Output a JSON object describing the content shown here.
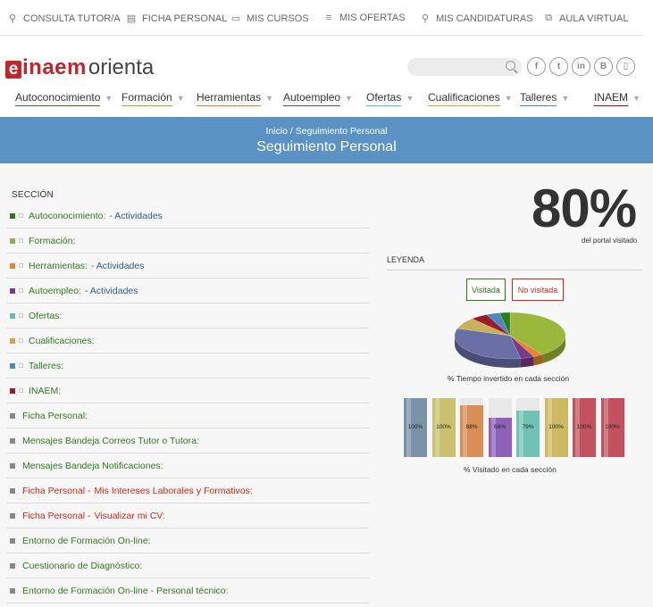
{
  "topbar": [
    {
      "icon": "consulta-icon",
      "glyph": "⚲",
      "label": "CONSULTA TUTOR/A"
    },
    {
      "icon": "ficha-icon",
      "glyph": "▤",
      "label": "FICHA PERSONAL"
    },
    {
      "icon": "cursos-icon",
      "glyph": "▭",
      "label": "MIS CURSOS"
    },
    {
      "icon": "ofertas-icon",
      "glyph": "≡",
      "label": "MIS OFERTAS"
    },
    {
      "icon": "candidaturas-icon",
      "glyph": "⚲",
      "label": "MIS CANDIDATURAS"
    },
    {
      "icon": "aula-icon",
      "glyph": "⧉",
      "label": "AULA VIRTUAL"
    }
  ],
  "header": {
    "logo_mark": "e",
    "logo_brand": "inaem",
    "logo_sub": "orienta",
    "search_placeholder": "",
    "socials": [
      {
        "icon": "facebook-icon",
        "glyph": "f"
      },
      {
        "icon": "twitter-icon",
        "glyph": "t"
      },
      {
        "icon": "linkedin-icon",
        "glyph": "in"
      },
      {
        "icon": "blogger-icon",
        "glyph": "B"
      },
      {
        "icon": "mobile-icon",
        "glyph": "▯"
      }
    ]
  },
  "mainnav": [
    {
      "label": "Autoconocimiento",
      "color": "#2e7a1a"
    },
    {
      "label": "Formación",
      "color": "#8cb83a"
    },
    {
      "label": "Herramientas",
      "color": "#e8862a"
    },
    {
      "label": "Autoempleo",
      "color": "#7a3a8c"
    },
    {
      "label": "Ofertas",
      "color": "#5ec0b8"
    },
    {
      "label": "Cualificaciones",
      "color": "#d4a937"
    },
    {
      "label": "Talleres",
      "color": "#4a88c0"
    },
    {
      "label": "INAEM",
      "color": "#9b1b2a"
    }
  ],
  "banner": {
    "breadcrumb": "Inicio / Seguimiento Personal",
    "title": "Seguimiento Personal"
  },
  "section_header": "SECCIÓN",
  "rows": [
    {
      "color": "#2e7a1a",
      "text": "Autoconocimiento:",
      "activity": "- Actividades",
      "kind": "section"
    },
    {
      "color": "#8cb83a",
      "text": "Formación:",
      "activity": "",
      "kind": "section"
    },
    {
      "color": "#e8862a",
      "text": "Herramientas:",
      "activity": "- Actividades",
      "kind": "section"
    },
    {
      "color": "#7a3a8c",
      "text": "Autoempleo:",
      "activity": "- Actividades",
      "kind": "section"
    },
    {
      "color": "#5ec0b8",
      "text": "Ofertas:",
      "activity": "",
      "kind": "section"
    },
    {
      "color": "#d4a937",
      "text": "Cualificaciones:",
      "activity": "",
      "kind": "section"
    },
    {
      "color": "#4a88c0",
      "text": "Talleres:",
      "activity": "",
      "kind": "section"
    },
    {
      "color": "#9b1b2a",
      "text": "INAEM:",
      "activity": "",
      "kind": "section"
    },
    {
      "color": "#888888",
      "text": "Ficha Personal:",
      "activity": "",
      "kind": "item"
    },
    {
      "color": "#888888",
      "text": "Mensajes Bandeja Correos Tutor o Tutora:",
      "activity": "",
      "kind": "item"
    },
    {
      "color": "#888888",
      "text": "Mensajes Bandeja Notificaciones:",
      "activity": "",
      "kind": "item"
    },
    {
      "color": "#888888",
      "text": "Ficha Personal -",
      "activity": "Mis Intereses Laborales y Formativos:",
      "kind": "red"
    },
    {
      "color": "#888888",
      "text": "Ficha Personal -",
      "activity": "Visualizar mi CV:",
      "kind": "red"
    },
    {
      "color": "#888888",
      "text": "Entorno de Formación On-line:",
      "activity": "",
      "kind": "item"
    },
    {
      "color": "#888888",
      "text": "Cuestionario de Diagnóstico:",
      "activity": "",
      "kind": "item"
    },
    {
      "color": "#888888",
      "text": "Entorno de Formación On-line - Personal técnico:",
      "activity": "",
      "kind": "item"
    }
  ],
  "summary": {
    "percent": "80%",
    "percent_caption": "del portal visitado",
    "legend_title": "LEYENDA",
    "legend_visited": "Visitada",
    "legend_not_visited": "No visitada",
    "pie_caption": "% Tiempo invertido en cada sección",
    "bar_caption": "% Visitado en cada sección"
  },
  "chart_data": [
    {
      "type": "pie",
      "title": "% Tiempo invertido en cada sección",
      "slices": [
        {
          "value": 40,
          "color": "#9ab83c"
        },
        {
          "value": 3,
          "color": "#e8862a"
        },
        {
          "value": 4,
          "color": "#7a3a8c"
        },
        {
          "value": 33,
          "color": "#6a6fa8"
        },
        {
          "value": 8,
          "color": "#c7b25a"
        },
        {
          "value": 5,
          "color": "#9b1b2a"
        },
        {
          "value": 4,
          "color": "#4a88c0"
        },
        {
          "value": 3,
          "color": "#2e7a1a"
        }
      ]
    },
    {
      "type": "bar",
      "title": "% Visitado en cada sección",
      "values": [
        100,
        100,
        88,
        66,
        79,
        100,
        100,
        100
      ],
      "labels": [
        "100%",
        "100%",
        "88%",
        "66%",
        "79%",
        "100%",
        "100%",
        "100%"
      ],
      "colors": [
        "#7a93a9",
        "#c9c070",
        "#d88e55",
        "#8e62b8",
        "#6fc3b0",
        "#cdb863",
        "#c2535e",
        "#c2535e"
      ],
      "ylim": [
        0,
        100
      ]
    }
  ]
}
